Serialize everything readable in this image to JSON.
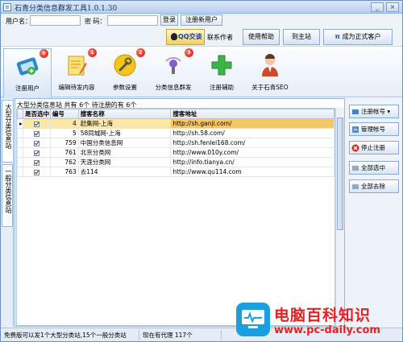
{
  "window": {
    "title": "石青分类信息群发工具1.0.1.30",
    "title_icon_glyph": "≡",
    "min_glyph": "_",
    "close_glyph": "×"
  },
  "login": {
    "username_label": "用户名：",
    "password_label": "密  码：",
    "login_button": "登录",
    "register_button": "注册新用户"
  },
  "actions": {
    "qq_button": "QQ交谈",
    "contact_label": "联系作者",
    "help_button": "使用帮助",
    "home_button": "到主站",
    "upgrade_button": "成为正式客户"
  },
  "toolbar": [
    {
      "label": "注册用户",
      "badge": "0",
      "icon": "register-user-icon",
      "color": "#2f86c9"
    },
    {
      "label": "编辑待发内容",
      "badge": "1",
      "icon": "edit-content-icon",
      "color": "#f0b63c"
    },
    {
      "label": "参数设置",
      "badge": "2",
      "icon": "settings-icon",
      "color": "#f2c318"
    },
    {
      "label": "分类信息群发",
      "badge": "3",
      "icon": "broadcast-icon",
      "color": "#8a5cc7"
    },
    {
      "label": "注册辅助",
      "badge": "",
      "icon": "assist-plus-icon",
      "color": "#3bb548"
    },
    {
      "label": "关于石青SEO",
      "badge": "",
      "icon": "about-person-icon",
      "color": "#d04a2a"
    }
  ],
  "tabs": {
    "big": "大型分类信息站",
    "general": "一般分类信息站"
  },
  "list": {
    "header": "大型分类信息站 共有 6个 待注册的有 6个",
    "columns": [
      "是否选中",
      "编号",
      "搜客名称",
      "搜客地址"
    ],
    "rows": [
      {
        "id": "4",
        "name": "赶集网-上海",
        "url": "http://sh.ganji.com/",
        "selected": true
      },
      {
        "id": "5",
        "name": "58同城网-上海",
        "url": "http://sh.58.com/",
        "selected": false
      },
      {
        "id": "759",
        "name": "中国分类信息网",
        "url": "http://sh.fenlei168.com/",
        "selected": false
      },
      {
        "id": "761",
        "name": "北京分类网",
        "url": "http://www.010y.com/",
        "selected": false
      },
      {
        "id": "762",
        "name": "天涯分类网",
        "url": "http://info.tianya.cn/",
        "selected": false
      },
      {
        "id": "763",
        "name": "去114",
        "url": "http://www.qu114.com",
        "selected": false
      }
    ]
  },
  "side": {
    "register_account": "注册帐号",
    "manage_account": "管理帐号",
    "stop_register": "停止注册",
    "select_all": "全部选中",
    "clear_all": "全部去除"
  },
  "status": {
    "left": "免费版可以发1个大型分类站,15个一般分类站",
    "right": "现在有代理 117个"
  },
  "watermark": {
    "title": "电脑百科知识",
    "url": "www.pc-daily.com"
  }
}
